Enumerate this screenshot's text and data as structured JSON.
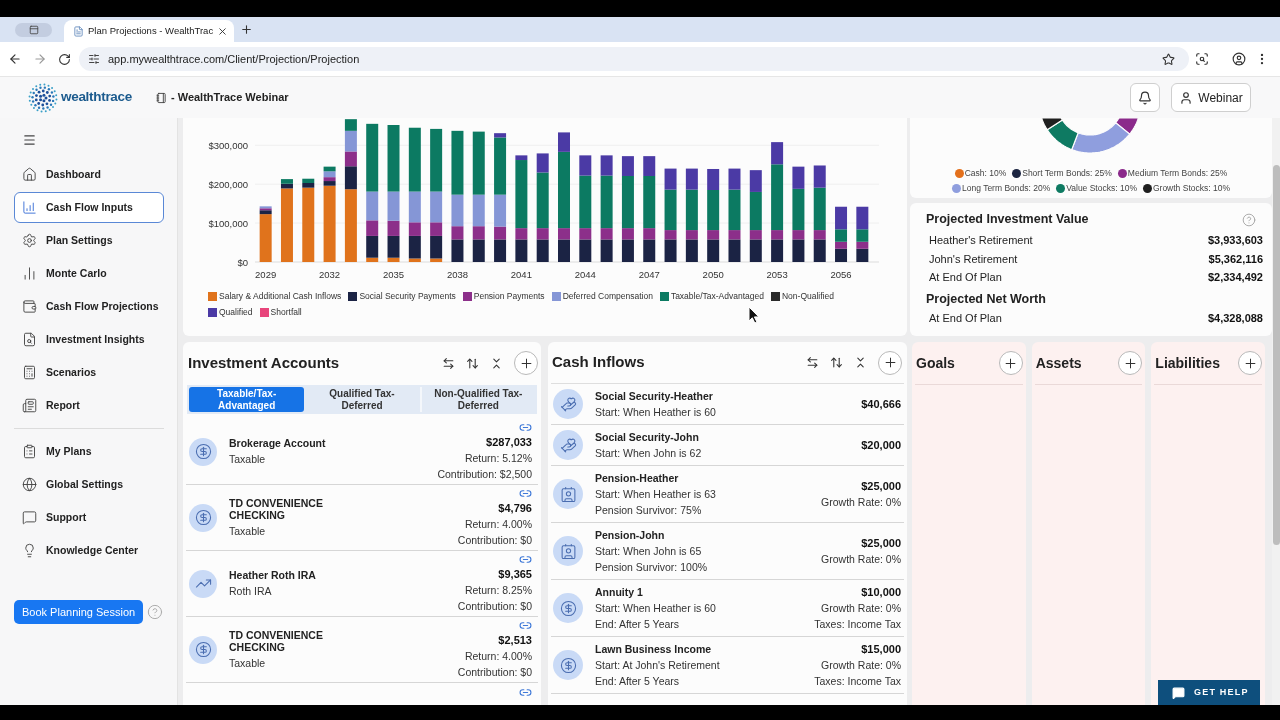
{
  "browser": {
    "tab_title": "Plan Projections - WealthTrac",
    "url": "app.mywealthtrace.com/Client/Projection/Projection"
  },
  "header": {
    "logo_text": "wealthtrace",
    "plan_title": "- WealthTrace Webinar",
    "user_button": "Webinar"
  },
  "sidebar": {
    "sections": [
      {
        "items": [
          {
            "label": "Dashboard",
            "selected": false
          },
          {
            "label": "Cash Flow Inputs",
            "selected": true
          },
          {
            "label": "Plan Settings",
            "selected": false
          },
          {
            "label": "Monte Carlo",
            "selected": false
          },
          {
            "label": "Cash Flow Projections",
            "selected": false
          },
          {
            "label": "Investment Insights",
            "selected": false
          },
          {
            "label": "Scenarios",
            "selected": false
          },
          {
            "label": "Report",
            "selected": false
          }
        ]
      },
      {
        "items": [
          {
            "label": "My Plans",
            "selected": false
          },
          {
            "label": "Global Settings",
            "selected": false
          },
          {
            "label": "Support",
            "selected": false
          },
          {
            "label": "Knowledge Center",
            "selected": false
          }
        ]
      }
    ],
    "book_button": "Book Planning Session"
  },
  "projection_chart": {
    "chart_data": {
      "type": "bar",
      "stacked": true,
      "grid": true,
      "legend": "bottom",
      "x": [
        2029,
        2030,
        2031,
        2032,
        2033,
        2034,
        2035,
        2036,
        2037,
        2038,
        2039,
        2040,
        2041,
        2042,
        2043,
        2044,
        2045,
        2046,
        2047,
        2048,
        2049,
        2050,
        2051,
        2052,
        2053,
        2054,
        2055,
        2056,
        2057
      ],
      "xlim": [
        2028.5,
        2057.5
      ],
      "xticks": [
        2029,
        2032,
        2035,
        2038,
        2041,
        2044,
        2047,
        2050,
        2053,
        2056
      ],
      "ylim": [
        0,
        370000
      ],
      "yticks": [
        {
          "value": 0,
          "label": "$0"
        },
        {
          "value": 100000,
          "label": "$100,000"
        },
        {
          "value": 200000,
          "label": "$200,000"
        },
        {
          "value": 300000,
          "label": "$300,000"
        }
      ],
      "series": [
        {
          "name": "Salary & Additional Cash Inflows",
          "color": "#e0731c",
          "values": [
            123000,
            189000,
            191000,
            196000,
            187000,
            11000,
            11000,
            9000,
            9000,
            0,
            0,
            0,
            0,
            0,
            0,
            0,
            0,
            0,
            0,
            0,
            0,
            0,
            0,
            0,
            0,
            0,
            0,
            0,
            0
          ]
        },
        {
          "name": "Social Security Payments",
          "color": "#1b2344",
          "values": [
            10000,
            12000,
            12000,
            12000,
            59000,
            56000,
            56000,
            58000,
            58000,
            58000,
            58000,
            58000,
            58000,
            58000,
            58000,
            58000,
            58000,
            58000,
            58000,
            58000,
            58000,
            58000,
            58000,
            58000,
            58000,
            58000,
            58000,
            34000,
            34000
          ]
        },
        {
          "name": "Pension Payments",
          "color": "#8c2f8a",
          "values": [
            5000,
            0,
            0,
            10000,
            38000,
            40000,
            39000,
            35000,
            35000,
            34000,
            34000,
            33000,
            29000,
            29000,
            29000,
            29000,
            29000,
            29000,
            29000,
            24000,
            24000,
            24000,
            24000,
            24000,
            24000,
            24000,
            24000,
            18000,
            18000
          ]
        },
        {
          "name": "Deferred Compensation",
          "color": "#8596d6",
          "values": [
            5000,
            0,
            0,
            15000,
            53000,
            74000,
            75000,
            79000,
            79000,
            81000,
            81000,
            82000,
            0,
            0,
            0,
            0,
            0,
            0,
            0,
            0,
            0,
            0,
            0,
            0,
            0,
            0,
            0,
            0,
            0
          ]
        },
        {
          "name": "Taxable/Tax-Advantaged",
          "color": "#0c7a62",
          "values": [
            0,
            12000,
            11000,
            12000,
            30000,
            174000,
            171000,
            164000,
            161000,
            164000,
            162000,
            147000,
            175000,
            143000,
            196000,
            135000,
            135000,
            134000,
            134000,
            104000,
            104000,
            103000,
            104000,
            98000,
            169000,
            106000,
            109000,
            32000,
            32000
          ]
        },
        {
          "name": "Non-Qualified",
          "color": "#2a2a2a",
          "values": [
            0,
            0,
            0,
            0,
            0,
            0,
            0,
            0,
            0,
            0,
            0,
            0,
            0,
            0,
            0,
            0,
            0,
            0,
            0,
            0,
            0,
            0,
            0,
            0,
            0,
            0,
            0,
            0,
            0
          ]
        },
        {
          "name": "Qualified",
          "color": "#4b3aa5",
          "values": [
            0,
            0,
            0,
            0,
            0,
            0,
            0,
            0,
            0,
            0,
            0,
            11000,
            12000,
            49000,
            50000,
            52000,
            52000,
            51000,
            51000,
            54000,
            54000,
            54000,
            54000,
            56000,
            57000,
            57000,
            57000,
            58000,
            58000
          ]
        },
        {
          "name": "Shortfall",
          "color": "#e8457b",
          "values": [
            0,
            0,
            0,
            0,
            0,
            0,
            0,
            0,
            0,
            0,
            0,
            0,
            0,
            0,
            0,
            0,
            0,
            0,
            0,
            0,
            0,
            0,
            0,
            0,
            0,
            0,
            0,
            0,
            0
          ]
        }
      ]
    }
  },
  "allocation": {
    "legend": [
      {
        "label": "Cash: 10%",
        "color": "#e3701c"
      },
      {
        "label": "Short Term Bonds: 25%",
        "color": "#1c2541"
      },
      {
        "label": "Medium Term Bonds: 25%",
        "color": "#8b2a8b"
      },
      {
        "label": "Long Term Bonds: 20%",
        "color": "#8f9ede"
      },
      {
        "label": "Value Stocks: 10%",
        "color": "#0e7a62"
      },
      {
        "label": "Growth Stocks: 10%",
        "color": "#1f1f1f"
      }
    ]
  },
  "summary": {
    "sections": [
      {
        "title": "Projected Investment Value",
        "help": true,
        "rows": [
          {
            "label": "Heather's Retirement",
            "value": "$3,933,603"
          },
          {
            "label": "John's Retirement",
            "value": "$5,362,116"
          },
          {
            "label": "At End Of Plan",
            "value": "$2,334,492"
          }
        ]
      },
      {
        "title": "Projected Net Worth",
        "rows": [
          {
            "label": "At End Of Plan",
            "value": "$4,328,088"
          }
        ]
      }
    ]
  },
  "investment_accounts": {
    "title": "Investment Accounts",
    "tabs": [
      {
        "label": "Taxable/Tax-Advantaged",
        "selected": true
      },
      {
        "label": "Qualified Tax-Deferred",
        "selected": false
      },
      {
        "label": "Non-Qualified Tax-Deferred",
        "selected": false
      }
    ],
    "accounts": [
      {
        "kind": "cash",
        "name": "Brokerage Account",
        "type": "Taxable",
        "amount": "$287,033",
        "return": "Return: 5.12%",
        "contribution": "Contribution: $2,500"
      },
      {
        "kind": "cash",
        "name": "TD CONVENIENCE CHECKING",
        "type": "Taxable",
        "amount": "$4,796",
        "return": "Return: 4.00%",
        "contribution": "Contribution: $0"
      },
      {
        "kind": "growth",
        "name": "Heather Roth IRA",
        "type": "Roth IRA",
        "amount": "$9,365",
        "return": "Return: 8.25%",
        "contribution": "Contribution: $0"
      },
      {
        "kind": "cash",
        "name": "TD CONVENIENCE CHECKING",
        "type": "Taxable",
        "amount": "$2,513",
        "return": "Return: 4.00%",
        "contribution": "Contribution: $0"
      }
    ],
    "next_row_link": true
  },
  "cash_inflows": {
    "title": "Cash Inflows",
    "rows": [
      {
        "kind": "social-security",
        "name": "Social Security-Heather",
        "details": [
          "Start: When Heather is 60"
        ],
        "amount": "$40,666"
      },
      {
        "kind": "social-security",
        "name": "Social Security-John",
        "details": [
          "Start: When John is 62"
        ],
        "amount": "$20,000"
      },
      {
        "kind": "pension",
        "name": "Pension-Heather",
        "details": [
          "Start: When Heather is 63",
          "Pension Survivor: 75%"
        ],
        "amount": "$25,000",
        "notes": [
          "Growth Rate: 0%"
        ]
      },
      {
        "kind": "pension",
        "name": "Pension-John",
        "details": [
          "Start: When John is 65",
          "Pension Survivor: 100%"
        ],
        "amount": "$25,000",
        "notes": [
          "Growth Rate: 0%"
        ]
      },
      {
        "kind": "income",
        "name": "Annuity 1",
        "details": [
          "Start: When Heather is 60",
          "End: After 5 Years"
        ],
        "amount": "$10,000",
        "notes": [
          "Growth Rate: 0%",
          "Taxes: Income Tax"
        ]
      },
      {
        "kind": "income",
        "name": "Lawn Business Income",
        "details": [
          "Start: At John's Retirement",
          "End: After 5 Years"
        ],
        "amount": "$15,000",
        "notes": [
          "Growth Rate: 0%",
          "Taxes: Income Tax"
        ]
      }
    ]
  },
  "side_panels": [
    {
      "title": "Goals"
    },
    {
      "title": "Assets"
    },
    {
      "title": "Liabilities"
    }
  ],
  "help_button": "GET HELP"
}
